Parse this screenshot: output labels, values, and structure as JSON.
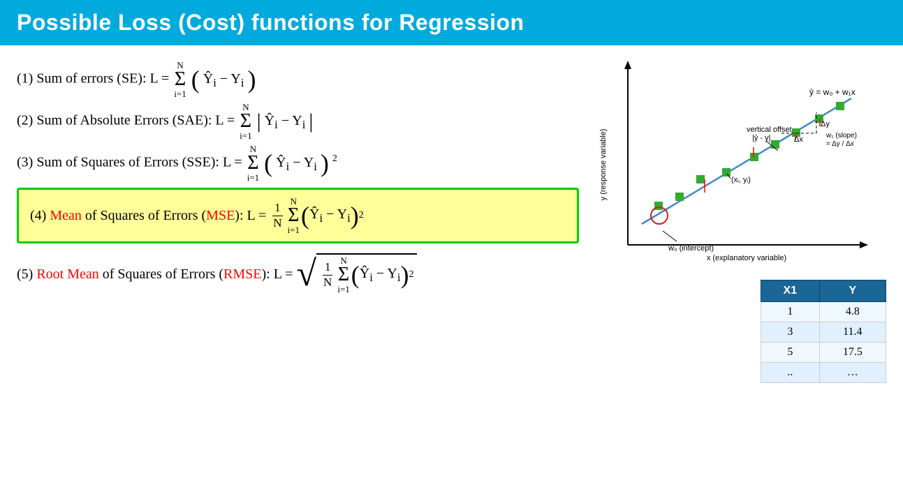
{
  "header": {
    "title": "Possible Loss (Cost) functions for Regression",
    "bg_color": "#00aadd"
  },
  "formulas": {
    "f1_label": "(1) Sum of errors (SE): L =",
    "f1_sum_top": "N",
    "f1_sum_bot": "i=1",
    "f2_label": "(2) Sum of Absolute Errors (SAE): L =",
    "f2_sum_top": "N",
    "f2_sum_bot": "i=1",
    "f3_label": "(3) Sum of Squares of Errors (SSE): L =",
    "f3_sum_top": "N",
    "f3_sum_bot": "i=1",
    "f4_prefix": "(4) ",
    "f4_mean": "Mean",
    "f4_middle": " of Squares of Errors (",
    "f4_mse": "MSE",
    "f4_suffix": "): L =",
    "f5_prefix": "(5) ",
    "f5_root_mean": "Root Mean",
    "f5_middle": " of Squares of Errors (",
    "f5_rmse": "RMSE",
    "f5_suffix": "): L ="
  },
  "table": {
    "col1_header": "X1",
    "col2_header": "Y",
    "rows": [
      {
        "x1": "1",
        "y": "4.8"
      },
      {
        "x1": "3",
        "y": "11.4"
      },
      {
        "x1": "5",
        "y": "17.5"
      },
      {
        "x1": "..",
        "y": "…"
      }
    ]
  },
  "chart": {
    "line_label": "ŷ = w₀ + w₁x",
    "offset_label": "vertical offset",
    "offset_sub": "|ŷ - y|",
    "delta_y": "Δy",
    "delta_x": "Δx",
    "slope_label": "w₁ (slope)",
    "slope_eq": "= Δy / Δx",
    "intercept_label": "w₀ (intercept)",
    "x_axis_label": "x (explanatory variable)",
    "y_axis_label": "y (response variable)",
    "point_label": "(xᵢ, yᵢ)"
  }
}
